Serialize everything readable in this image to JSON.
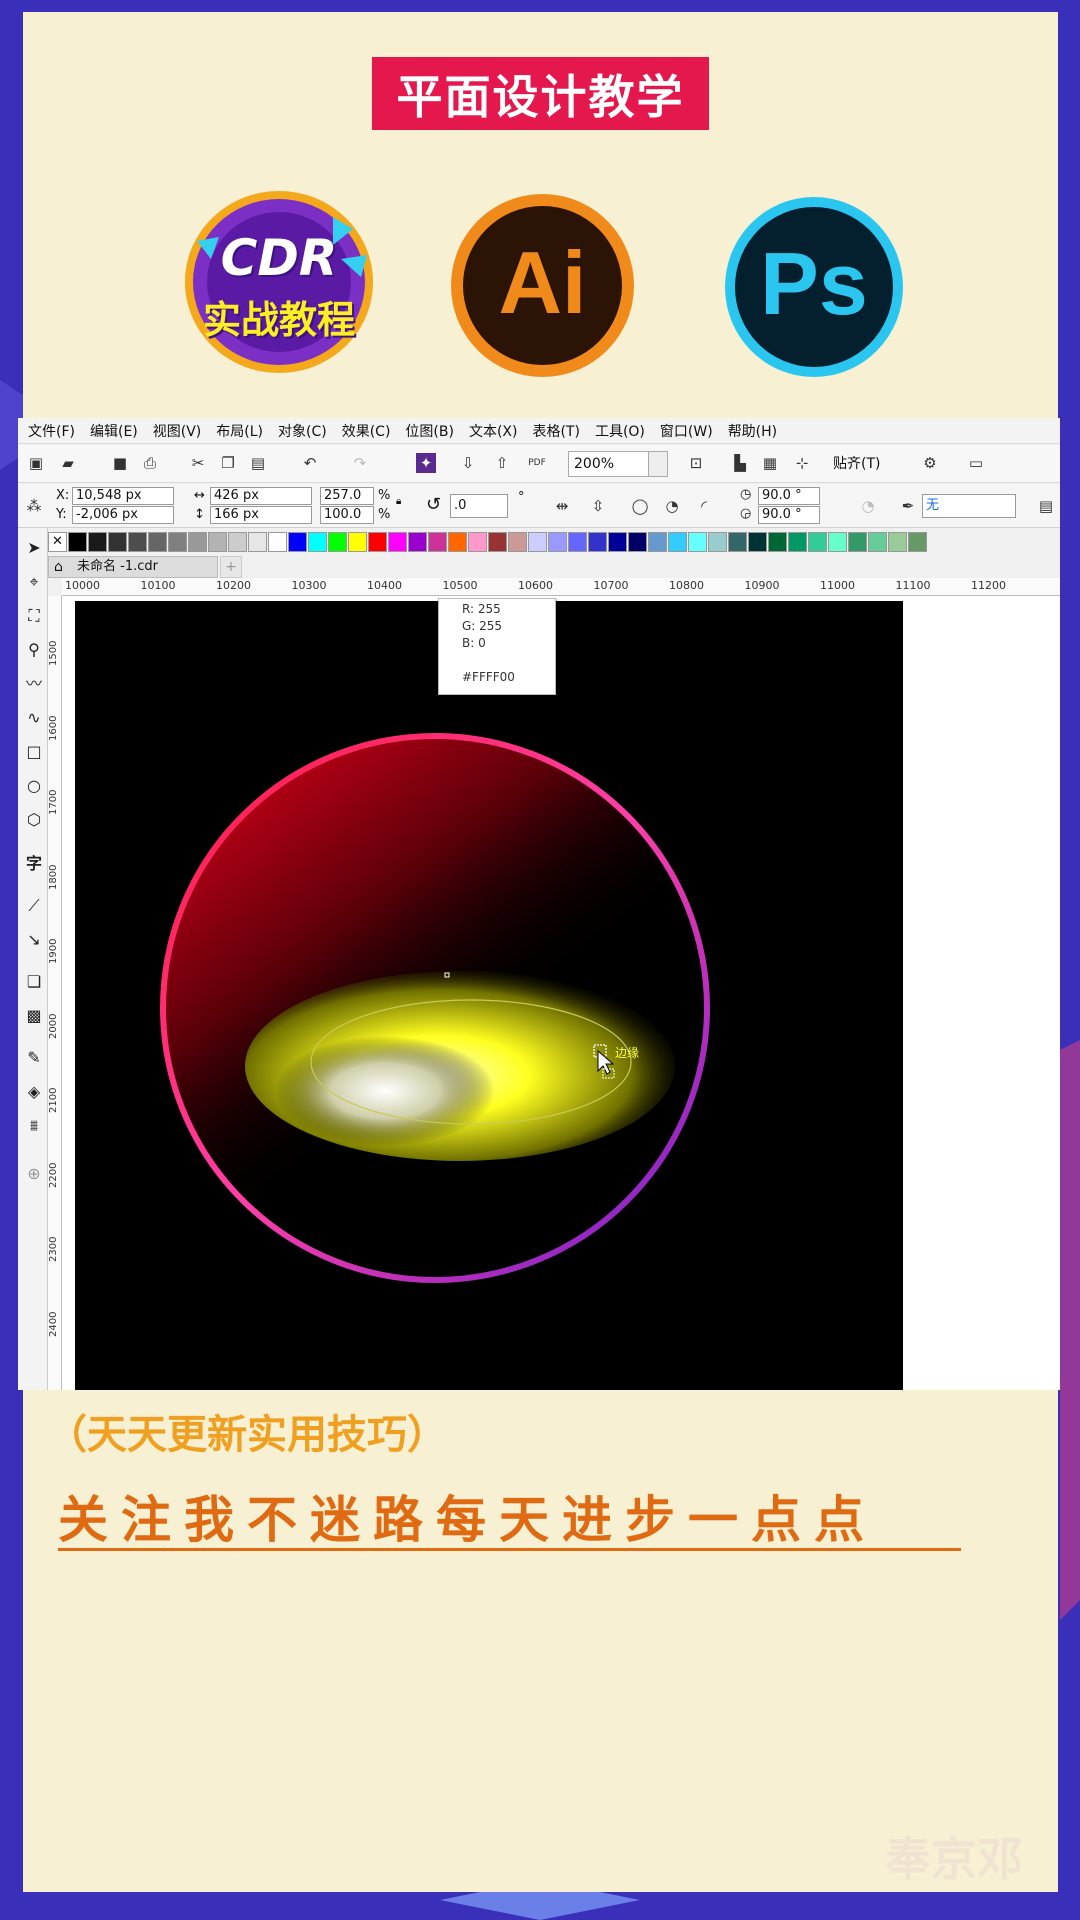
{
  "header": {
    "title": "平面设计教学"
  },
  "logos": [
    {
      "icon": "cdr-logo-icon",
      "line1": "CDR",
      "line2": "实战教程"
    },
    {
      "icon": "ai-logo-icon",
      "text": "Ai"
    },
    {
      "icon": "ps-logo-icon",
      "text": "Ps"
    }
  ],
  "menu": [
    "文件(F)",
    "编辑(E)",
    "视图(V)",
    "布局(L)",
    "对象(C)",
    "效果(C)",
    "位图(B)",
    "文本(X)",
    "表格(T)",
    "工具(O)",
    "窗口(W)",
    "帮助(H)"
  ],
  "toolbar": {
    "zoom": "200%",
    "snap": "贴齐(T)",
    "pdf": "PDF"
  },
  "props": {
    "x_label": "X:",
    "x": "10,548 px",
    "y_label": "Y:",
    "y": "-2,006 px",
    "w": "426 px",
    "h": "166 px",
    "sx": "257.0",
    "sy": "100.0",
    "pct": "%",
    "rotation": ".0",
    "deg": "°",
    "angle1": "90.0 °",
    "angle2": "90.0 °",
    "fill_select": "无"
  },
  "palette": [
    "#ffffff",
    "#000000",
    "#1a1a1a",
    "#333333",
    "#4d4d4d",
    "#666666",
    "#808080",
    "#999999",
    "#b3b3b3",
    "#cccccc",
    "#e6e6e6",
    "#ffffff",
    "#0000ff",
    "#00ffff",
    "#00ff00",
    "#ffff00",
    "#ff0000",
    "#ff00ff",
    "#9900cc",
    "#cc3399",
    "#ff6600",
    "#ff99cc",
    "#993333",
    "#cc9999",
    "#ccccff",
    "#9999ff",
    "#6666ff",
    "#3333cc",
    "#000099",
    "#000066",
    "#6699cc",
    "#33ccff",
    "#66ffff",
    "#99cccc",
    "#336666",
    "#003333",
    "#006633",
    "#009966",
    "#33cc99",
    "#66ffcc",
    "#339966",
    "#66cc99",
    "#99cc99",
    "#669966"
  ],
  "document": {
    "tab": "未命名 -1.cdr"
  },
  "ruler_h": [
    "10000",
    "10100",
    "10200",
    "10300",
    "10400",
    "10500",
    "10600",
    "10700",
    "10800",
    "10900",
    "11000",
    "11100",
    "11200"
  ],
  "ruler_v": [
    "1500",
    "1600",
    "1700",
    "1800",
    "1900",
    "2000",
    "2100",
    "2200",
    "2300",
    "2400"
  ],
  "color_popup": {
    "r": "R: 255",
    "g": "G: 255",
    "b": "B: 0",
    "hex": "#FFFF00"
  },
  "cursor_label": "边缘",
  "captions": {
    "line1": "（天天更新实用技巧）",
    "line2": "关注我不迷路每天进步一点点"
  },
  "watermark": "奉京邓",
  "colors": {
    "background": "#3a2fb8",
    "panel": "#f7f0d3",
    "title_bg": "#e5184e",
    "caption1": "#f0a020",
    "caption2": "#e06a12"
  }
}
